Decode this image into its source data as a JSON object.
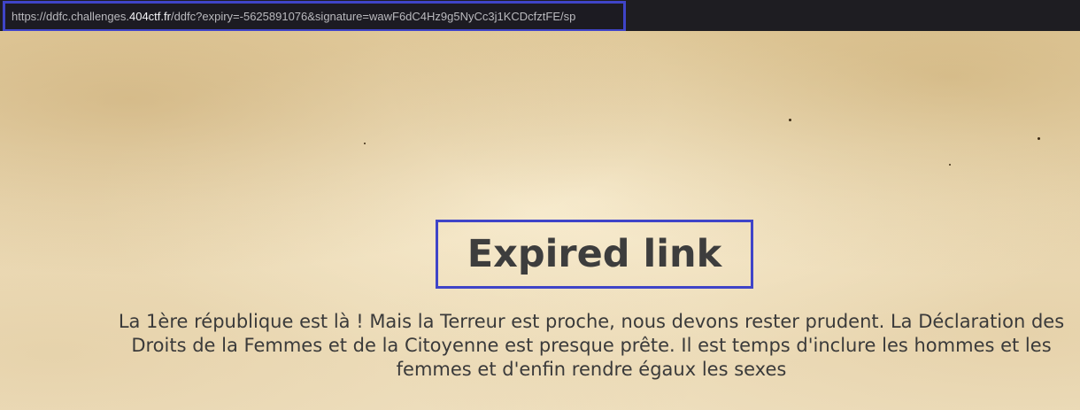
{
  "browser": {
    "url_prefix": "https://ddfc.challenges.",
    "url_domain": "404ctf.fr",
    "url_suffix": "/ddfc?expiry=-5625891076&signature=wawF6dC4Hz9g5NyCc3j1KCDcfztFE/sp"
  },
  "page": {
    "heading": "Expired link",
    "message": "La 1ère république est là ! Mais la Terreur est proche, nous devons rester prudent. La Déclaration des Droits de la Femmes et de la Citoyenne est presque prête. Il est temps d'inclure les hommes et les femmes et d'enfin rendre égaux les sexes"
  },
  "colors": {
    "highlight_border": "#3f44c8",
    "browser_bar": "#1e1d22",
    "text": "#3d3d3d",
    "parchment": "#efdfbc"
  }
}
